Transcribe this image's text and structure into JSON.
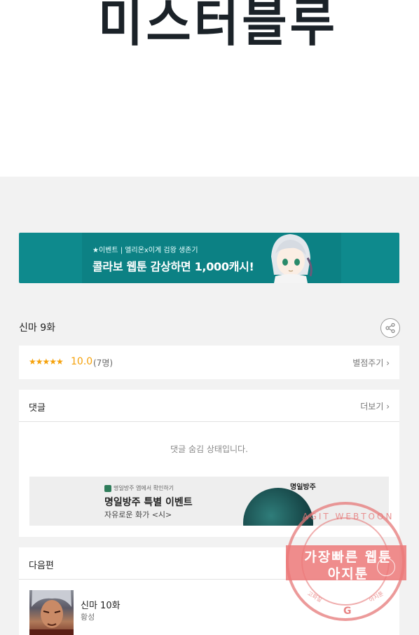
{
  "header": {
    "title": "미스터블루"
  },
  "banner": {
    "small_text": "★이벤트 | 엘리온x이계 검왕 생존기",
    "big_text": "콜라보 웹툰 감상하면 1,000캐시!"
  },
  "episode": {
    "title": "신마 9화",
    "share_icon": "share-icon"
  },
  "rating": {
    "stars": "★★★★★",
    "score": "10.0",
    "count": "(7명)",
    "rate_link": "별점주기 ›"
  },
  "comments": {
    "label": "댓글",
    "more_link": "더보기 ›",
    "hidden_message": "댓글 숨김 상태입니다."
  },
  "ad": {
    "small_text": "명일방주 앱에서 확인하기",
    "title": "명일방주 특별 이벤트",
    "subtitle": "자유로운 화가 <시>",
    "logo": "명일방주"
  },
  "next": {
    "label": "다음편",
    "episode_title": "신마 10화",
    "author": "황성"
  },
  "watermark": {
    "arc_text": "AGIT WEBTOON",
    "line1": "가장빠른 웹툰",
    "line2": "아지툰",
    "bottom_left": "고화질",
    "bottom_right": "아지툰",
    "g_mark": "G"
  },
  "colors": {
    "banner_bg": "#0e8a8d",
    "star": "#f5a10a",
    "watermark": "#e67878"
  }
}
